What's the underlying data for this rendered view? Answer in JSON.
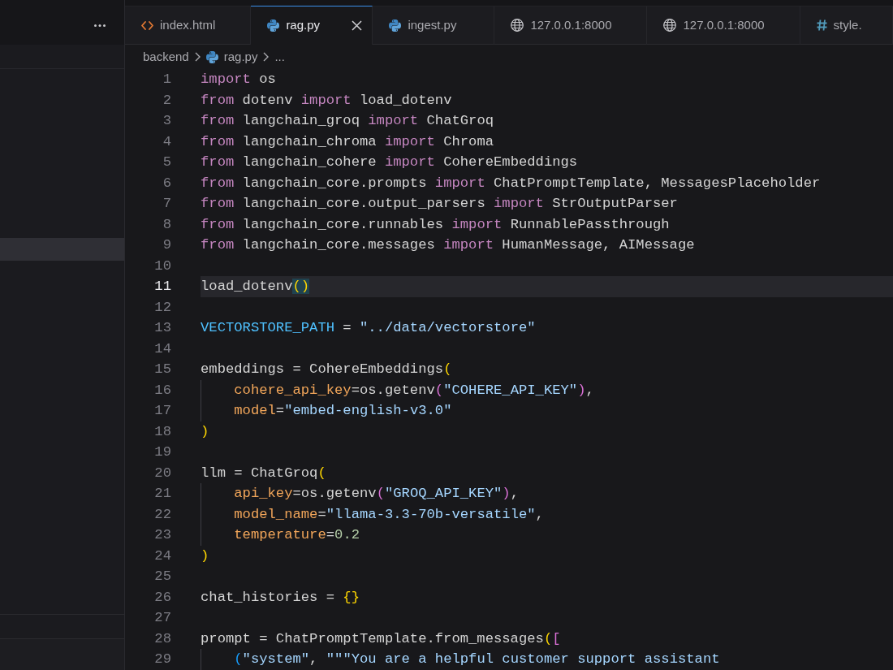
{
  "sidebar": {
    "rows": [
      {
        "selected": true
      }
    ]
  },
  "tabs": [
    {
      "label": "index.html",
      "kind": "html",
      "selected": false
    },
    {
      "label": "rag.py",
      "kind": "python",
      "selected": true
    },
    {
      "label": "ingest.py",
      "kind": "python",
      "selected": false
    },
    {
      "label": "127.0.0.1:8000",
      "kind": "web",
      "selected": false
    },
    {
      "label": "127.0.0.1:8000",
      "kind": "web",
      "selected": false
    },
    {
      "label": "style.",
      "kind": "css",
      "selected": false
    }
  ],
  "breadcrumb": [
    {
      "label": "backend",
      "kind": "folder"
    },
    {
      "label": "rag.py",
      "kind": "python"
    },
    {
      "label": "...",
      "kind": "symbol"
    }
  ],
  "editor": {
    "lines": [
      {
        "number": "1",
        "current": false,
        "tokens": [
          {
            "kind": "keyword",
            "text": "import"
          },
          {
            "kind": "text",
            "text": " os"
          }
        ]
      },
      {
        "number": "2",
        "current": false,
        "tokens": [
          {
            "kind": "keyword",
            "text": "from"
          },
          {
            "kind": "text",
            "text": " dotenv "
          },
          {
            "kind": "keyword",
            "text": "import"
          },
          {
            "kind": "text",
            "text": " load_dotenv"
          }
        ]
      },
      {
        "number": "3",
        "current": false,
        "tokens": [
          {
            "kind": "keyword",
            "text": "from"
          },
          {
            "kind": "text",
            "text": " langchain_groq "
          },
          {
            "kind": "keyword",
            "text": "import"
          },
          {
            "kind": "text",
            "text": " ChatGroq"
          }
        ]
      },
      {
        "number": "4",
        "current": false,
        "tokens": [
          {
            "kind": "keyword",
            "text": "from"
          },
          {
            "kind": "text",
            "text": " langchain_chroma "
          },
          {
            "kind": "keyword",
            "text": "import"
          },
          {
            "kind": "text",
            "text": " Chroma"
          }
        ]
      },
      {
        "number": "5",
        "current": false,
        "tokens": [
          {
            "kind": "keyword",
            "text": "from"
          },
          {
            "kind": "text",
            "text": " langchain_cohere "
          },
          {
            "kind": "keyword",
            "text": "import"
          },
          {
            "kind": "text",
            "text": " CohereEmbeddings"
          }
        ]
      },
      {
        "number": "6",
        "current": false,
        "tokens": [
          {
            "kind": "keyword",
            "text": "from"
          },
          {
            "kind": "text",
            "text": " langchain_core.prompts "
          },
          {
            "kind": "keyword",
            "text": "import"
          },
          {
            "kind": "text",
            "text": " ChatPromptTemplate, MessagesPlaceholder"
          }
        ]
      },
      {
        "number": "7",
        "current": false,
        "tokens": [
          {
            "kind": "keyword",
            "text": "from"
          },
          {
            "kind": "text",
            "text": " langchain_core.output_parsers "
          },
          {
            "kind": "keyword",
            "text": "import"
          },
          {
            "kind": "text",
            "text": " StrOutputParser"
          }
        ]
      },
      {
        "number": "8",
        "current": false,
        "tokens": [
          {
            "kind": "keyword",
            "text": "from"
          },
          {
            "kind": "text",
            "text": " langchain_core.runnables "
          },
          {
            "kind": "keyword",
            "text": "import"
          },
          {
            "kind": "text",
            "text": " RunnablePassthrough"
          }
        ]
      },
      {
        "number": "9",
        "current": false,
        "tokens": [
          {
            "kind": "keyword",
            "text": "from"
          },
          {
            "kind": "text",
            "text": " langchain_core.messages "
          },
          {
            "kind": "keyword",
            "text": "import"
          },
          {
            "kind": "text",
            "text": " HumanMessage, AIMessage"
          }
        ]
      },
      {
        "number": "10",
        "current": false
      },
      {
        "number": "11",
        "current": true,
        "tokens": [
          {
            "kind": "text",
            "text": "load_dotenv"
          },
          {
            "kind": "bracket",
            "text": "(",
            "matched": true
          },
          {
            "kind": "bracket",
            "text": ")",
            "matched": true
          }
        ]
      },
      {
        "number": "12",
        "current": false
      },
      {
        "number": "13",
        "current": false,
        "tokens": [
          {
            "kind": "constant",
            "text": "VECTORSTORE_PATH"
          },
          {
            "kind": "text",
            "text": " = "
          },
          {
            "kind": "string",
            "text": "\"../data/vectorstore\""
          }
        ]
      },
      {
        "number": "14",
        "current": false
      },
      {
        "number": "15",
        "current": false,
        "tokens": [
          {
            "kind": "text",
            "text": "embeddings = CohereEmbeddings"
          },
          {
            "kind": "bracket",
            "text": "(",
            "matched": false
          }
        ]
      },
      {
        "number": "16",
        "current": false,
        "tokens": [
          {
            "kind": "parameter",
            "text": "    cohere_api_key"
          },
          {
            "kind": "text",
            "text": "=os.getenv"
          },
          {
            "kind": "bracket2",
            "text": "(",
            "matched": false
          },
          {
            "kind": "string",
            "text": "\"COHERE_API_KEY\""
          },
          {
            "kind": "bracket2",
            "text": ")",
            "matched": false
          },
          {
            "kind": "text",
            "text": ","
          }
        ]
      },
      {
        "number": "17",
        "current": false,
        "tokens": [
          {
            "kind": "parameter",
            "text": "    model"
          },
          {
            "kind": "text",
            "text": "="
          },
          {
            "kind": "string",
            "text": "\"embed-english-v3.0\""
          }
        ]
      },
      {
        "number": "18",
        "current": false,
        "tokens": [
          {
            "kind": "bracket",
            "text": ")",
            "matched": false
          }
        ]
      },
      {
        "number": "19",
        "current": false
      },
      {
        "number": "20",
        "current": false,
        "tokens": [
          {
            "kind": "text",
            "text": "llm = ChatGroq"
          },
          {
            "kind": "bracket",
            "text": "(",
            "matched": false
          }
        ]
      },
      {
        "number": "21",
        "current": false,
        "tokens": [
          {
            "kind": "parameter",
            "text": "    api_key"
          },
          {
            "kind": "text",
            "text": "=os.getenv"
          },
          {
            "kind": "bracket2",
            "text": "(",
            "matched": false
          },
          {
            "kind": "string",
            "text": "\"GROQ_API_KEY\""
          },
          {
            "kind": "bracket2",
            "text": ")",
            "matched": false
          },
          {
            "kind": "text",
            "text": ","
          }
        ]
      },
      {
        "number": "22",
        "current": false,
        "tokens": [
          {
            "kind": "parameter",
            "text": "    model_name"
          },
          {
            "kind": "text",
            "text": "="
          },
          {
            "kind": "string",
            "text": "\"llama-3.3-70b-versatile\""
          },
          {
            "kind": "text",
            "text": ","
          }
        ]
      },
      {
        "number": "23",
        "current": false,
        "tokens": [
          {
            "kind": "parameter",
            "text": "    temperature"
          },
          {
            "kind": "text",
            "text": "="
          },
          {
            "kind": "number",
            "text": "0.2"
          }
        ]
      },
      {
        "number": "24",
        "current": false,
        "tokens": [
          {
            "kind": "bracket",
            "text": ")",
            "matched": false
          }
        ]
      },
      {
        "number": "25",
        "current": false
      },
      {
        "number": "26",
        "current": false,
        "tokens": [
          {
            "kind": "text",
            "text": "chat_histories = "
          },
          {
            "kind": "bracket",
            "text": "{",
            "matched": false
          },
          {
            "kind": "bracket",
            "text": "}",
            "matched": false
          }
        ]
      },
      {
        "number": "27",
        "current": false
      },
      {
        "number": "28",
        "current": false,
        "tokens": [
          {
            "kind": "text",
            "text": "prompt = ChatPromptTemplate.from_messages"
          },
          {
            "kind": "bracket",
            "text": "(",
            "matched": false
          },
          {
            "kind": "bracket2",
            "text": "[",
            "matched": false
          }
        ]
      },
      {
        "number": "29",
        "current": false,
        "tokens": [
          {
            "kind": "bracket3",
            "text": "    (",
            "matched": false
          },
          {
            "kind": "string",
            "text": "\"system\""
          },
          {
            "kind": "text",
            "text": ", "
          },
          {
            "kind": "string",
            "text": "\"\"\"You are a helpful customer support assistant"
          }
        ]
      }
    ]
  }
}
